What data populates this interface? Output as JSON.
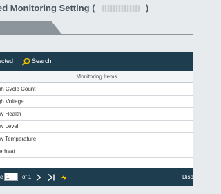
{
  "title": {
    "text": "ed Monitoring Setting (",
    "close_paren": ")"
  },
  "toolbar": {
    "selected_label": "ected",
    "search_label": "Search"
  },
  "table": {
    "header": "Monitoring Items",
    "rows": [
      "igh Cycle Count",
      "igh Voltage",
      "ow Health",
      "ow Level",
      "ow Temperature",
      "verheat"
    ]
  },
  "pager": {
    "page_prefix": "e",
    "page_value": "1",
    "of_label": "of 1",
    "display_label": "Disp"
  },
  "icons": {
    "search": "search-icon",
    "next": "chevron-right-icon",
    "last": "last-page-icon",
    "refresh": "refresh-bolt-icon"
  },
  "colors": {
    "toolbar_bg": "#1e3d4f",
    "accent": "#f2c200",
    "tab": "#8d959c"
  }
}
